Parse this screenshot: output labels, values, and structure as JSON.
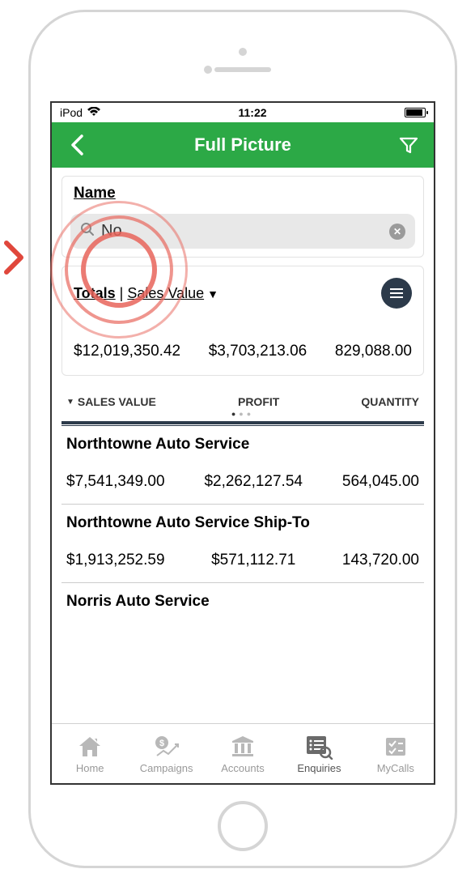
{
  "status": {
    "carrier": "iPod",
    "time": "11:22"
  },
  "header": {
    "title": "Full Picture"
  },
  "section_label": "Name",
  "search": {
    "value": "No"
  },
  "totals": {
    "label_totals": "Totals",
    "label_metric": "Sales Value",
    "sales_value": "$12,019,350.42",
    "profit": "$3,703,213.06",
    "quantity": "829,088.00"
  },
  "columns": {
    "c1": "SALES VALUE",
    "c2": "PROFIT",
    "c3": "QUANTITY"
  },
  "results": [
    {
      "name": "Northtowne Auto Service",
      "sales_value": "$7,541,349.00",
      "profit": "$2,262,127.54",
      "quantity": "564,045.00"
    },
    {
      "name": "Northtowne Auto Service Ship-To",
      "sales_value": "$1,913,252.59",
      "profit": "$571,112.71",
      "quantity": "143,720.00"
    },
    {
      "name": "Norris Auto Service",
      "sales_value": "",
      "profit": "",
      "quantity": ""
    }
  ],
  "tabs": {
    "home": "Home",
    "campaigns": "Campaigns",
    "accounts": "Accounts",
    "enquiries": "Enquiries",
    "mycalls": "MyCalls"
  }
}
